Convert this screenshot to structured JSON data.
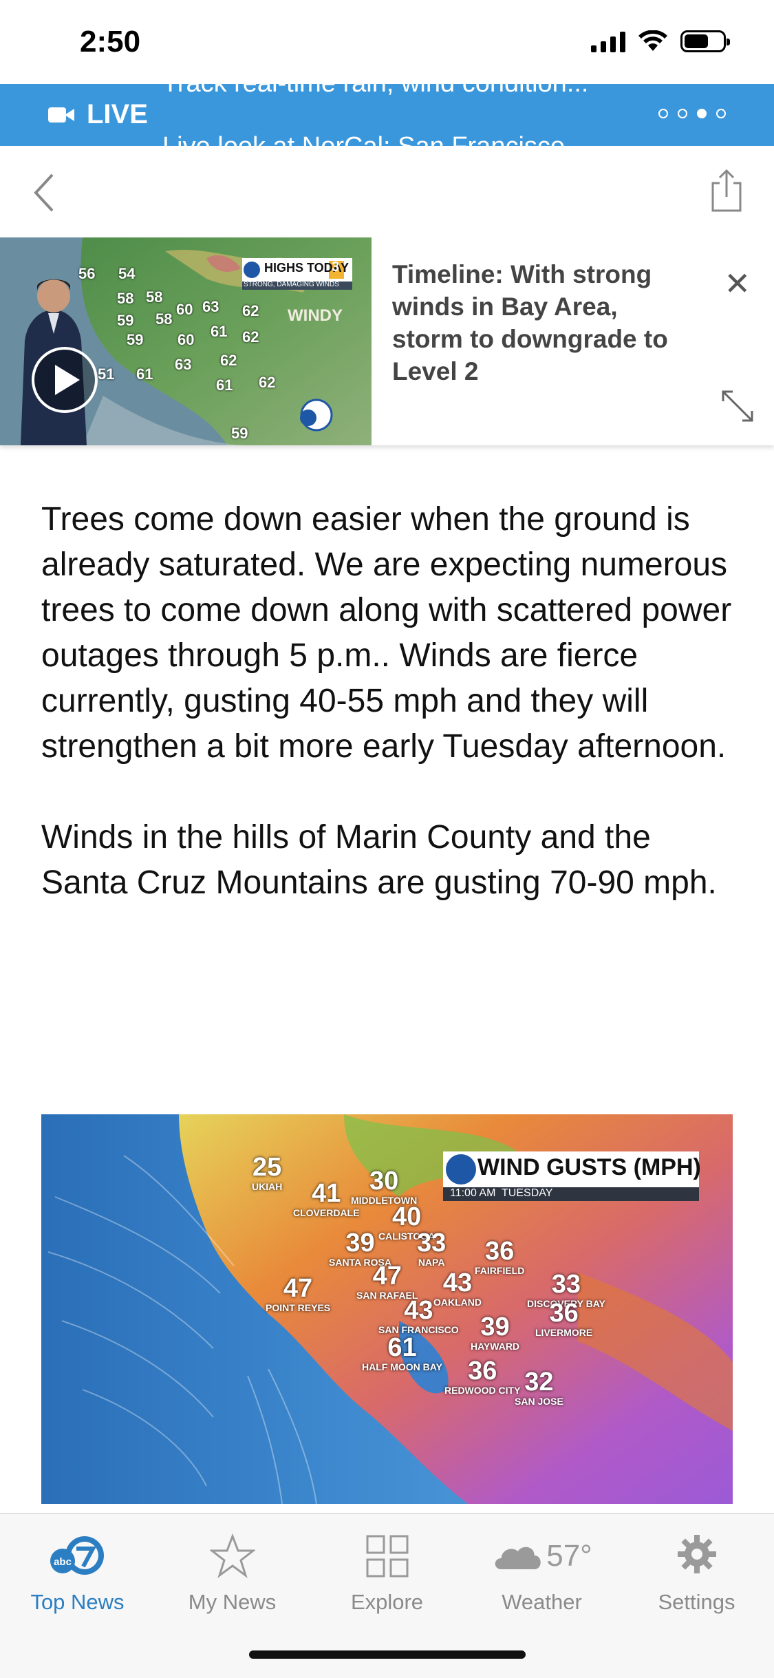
{
  "status_bar": {
    "time": "2:50"
  },
  "live_banner": {
    "label": "LIVE",
    "ticker_prev": "Track real-time rain, wind condition...",
    "ticker_next": "Live look at NorCal: San Francisco...",
    "page_count": 4,
    "active_page": 3
  },
  "video": {
    "title": "Timeline: With strong winds in Bay Area, storm to downgrade to Level 2",
    "thumb_header": "HIGHS TODAY",
    "thumb_badge": "3",
    "thumb_subheader": "STRONG, DAMAGING WINDS",
    "thumb_windy": "WINDY",
    "thumb_temps": [
      "56",
      "54",
      "58",
      "58",
      "60",
      "63",
      "59",
      "58",
      "62",
      "61",
      "59",
      "60",
      "62",
      "63",
      "62",
      "61",
      "62",
      "51",
      "61",
      "59"
    ]
  },
  "article": {
    "paragraphs": [
      "Trees come down easier when the ground is already saturated. We are expecting numerous trees to come down along with scattered power outages through 5 p.m.. Winds are fierce currently, gusting 40-55 mph and they will strengthen a bit more early Tuesday afternoon.",
      "Winds in the hills of Marin County and the Santa Cruz Mountains are gusting 70-90 mph."
    ]
  },
  "wind_map": {
    "title": "WIND GUSTS (MPH)",
    "time": "11:00 AM  TUESDAY",
    "readings": [
      {
        "value": "25",
        "place": "UKIAH"
      },
      {
        "value": "41",
        "place": "CLOVERDALE"
      },
      {
        "value": "30",
        "place": "MIDDLETOWN"
      },
      {
        "value": "40",
        "place": "CALISTOGA"
      },
      {
        "value": "39",
        "place": "SANTA ROSA"
      },
      {
        "value": "33",
        "place": "NAPA"
      },
      {
        "value": "36",
        "place": "FAIRFIELD"
      },
      {
        "value": "47",
        "place": "SAN RAFAEL"
      },
      {
        "value": "47",
        "place": "POINT REYES"
      },
      {
        "value": "43",
        "place": "OAKLAND"
      },
      {
        "value": "33",
        "place": "DISCOVERY BAY"
      },
      {
        "value": "43",
        "place": "SAN FRANCISCO"
      },
      {
        "value": "39",
        "place": "HAYWARD"
      },
      {
        "value": "36",
        "place": "LIVERMORE"
      },
      {
        "value": "61",
        "place": "HALF MOON BAY"
      },
      {
        "value": "36",
        "place": "REDWOOD CITY"
      },
      {
        "value": "32",
        "place": "SAN JOSE"
      }
    ]
  },
  "tabs": [
    {
      "label": "Top News",
      "icon": "abc7-logo-icon",
      "active": true
    },
    {
      "label": "My News",
      "icon": "star-icon",
      "active": false
    },
    {
      "label": "Explore",
      "icon": "grid-icon",
      "active": false
    },
    {
      "label": "Weather",
      "icon": "cloud-icon",
      "temp": "57°",
      "active": false
    },
    {
      "label": "Settings",
      "icon": "gear-icon",
      "active": false
    }
  ],
  "colors": {
    "live_blue": "#3b97dc",
    "tab_active": "#2b7ec1",
    "tab_inactive": "#8a8a8a"
  }
}
